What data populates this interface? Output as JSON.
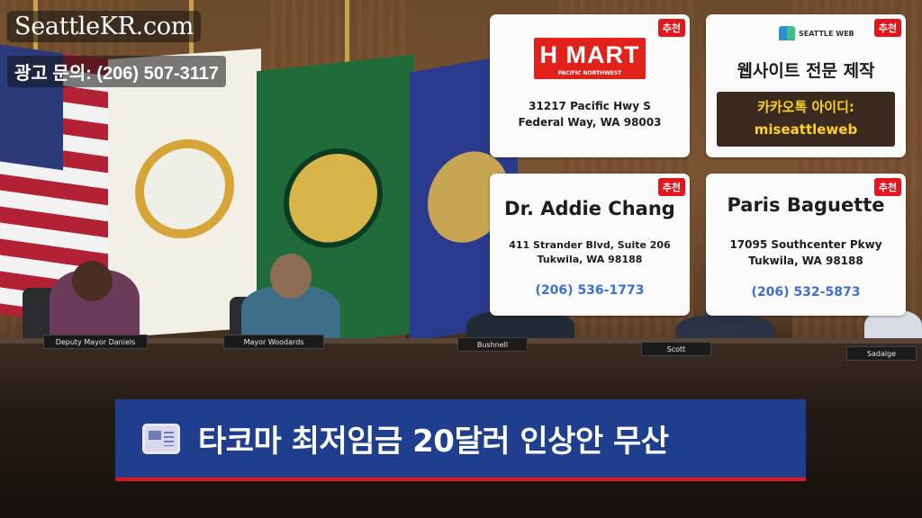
{
  "brand": {
    "name": "SeattleKR.com",
    "ad_contact": "광고 문의: (206) 507-3117"
  },
  "badge_label": "추천",
  "cards": {
    "hmart": {
      "logo_text": "H MART",
      "logo_sub": "PACIFIC NORTHWEST",
      "address_line1": "31217 Pacific Hwy S",
      "address_line2": "Federal Way, WA 98003"
    },
    "seattleweb": {
      "logo_text": "SEATTLE WEB",
      "headline": "웹사이트 전문 제작",
      "kakao_label": "카카오톡 아이디:",
      "kakao_id": "miseattleweb"
    },
    "chang": {
      "title": "Dr. Addie Chang",
      "address_line1": "411 Strander Blvd, Suite 206",
      "address_line2": "Tukwila, WA 98188",
      "phone": "(206) 536-1773"
    },
    "paris": {
      "title": "Paris Baguette",
      "address_line1": "17095 Southcenter Pkwy",
      "address_line2": "Tukwila, WA 98188",
      "phone": "(206) 532-5873"
    }
  },
  "nameplates": [
    "Deputy Mayor Daniels",
    "Mayor Woodards",
    "Bushnell",
    "Scott",
    "Sadalge"
  ],
  "headline": "타코마 최저임금 20달러 인상안 무산",
  "colors": {
    "badge": "#e4151b",
    "headline_bar": "#1f3f8e",
    "phone": "#3a6fd6",
    "kakao_text": "#ffd21f"
  }
}
